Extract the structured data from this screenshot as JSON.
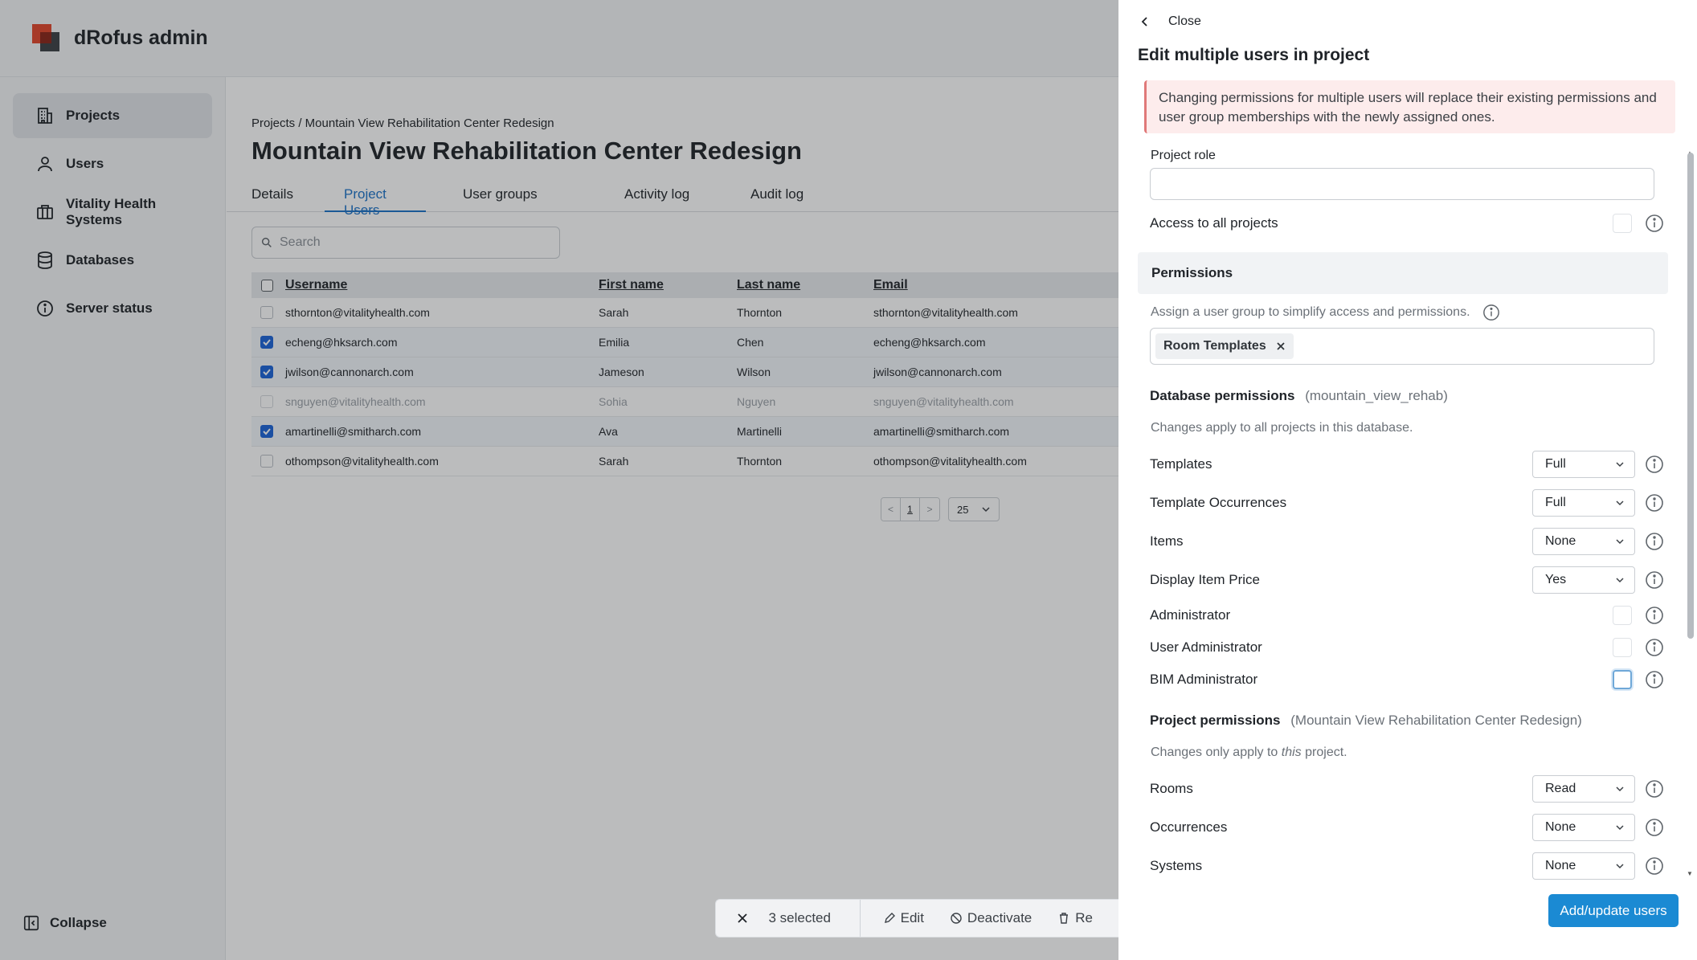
{
  "app": {
    "title": "dRofus admin"
  },
  "sidebar": {
    "items": [
      {
        "label": "Projects",
        "icon": "building-icon",
        "active": true
      },
      {
        "label": "Users",
        "icon": "user-icon",
        "active": false
      },
      {
        "label": "Vitality Health Systems",
        "icon": "briefcase-icon",
        "active": false
      },
      {
        "label": "Databases",
        "icon": "database-icon",
        "active": false
      },
      {
        "label": "Server status",
        "icon": "info-circle-icon",
        "active": false
      }
    ],
    "collapse_label": "Collapse"
  },
  "main": {
    "breadcrumb": "Projects / Mountain View Rehabilitation Center Redesign",
    "title": "Mountain View Rehabilitation Center Redesign",
    "tabs": [
      {
        "label": "Details",
        "active": false
      },
      {
        "label": "Project Users",
        "active": true
      },
      {
        "label": "User groups",
        "active": false
      },
      {
        "label": "Activity log",
        "active": false
      },
      {
        "label": "Audit log",
        "active": false
      }
    ],
    "search_placeholder": "Search",
    "table": {
      "headers": {
        "username": "Username",
        "first": "First name",
        "last": "Last name",
        "email": "Email"
      },
      "rows": [
        {
          "username": "sthornton@vitalityhealth.com",
          "first": "Sarah",
          "last": "Thornton",
          "email": "sthornton@vitalityhealth.com",
          "checked": false,
          "disabled": false
        },
        {
          "username": "echeng@hksarch.com",
          "first": "Emilia",
          "last": "Chen",
          "email": "echeng@hksarch.com",
          "checked": true,
          "disabled": false
        },
        {
          "username": "jwilson@cannonarch.com",
          "first": "Jameson",
          "last": "Wilson",
          "email": "jwilson@cannonarch.com",
          "checked": true,
          "disabled": false
        },
        {
          "username": "snguyen@vitalityhealth.com",
          "first": "Sohia",
          "last": "Nguyen",
          "email": "snguyen@vitalityhealth.com",
          "checked": false,
          "disabled": true
        },
        {
          "username": "amartinelli@smitharch.com",
          "first": "Ava",
          "last": "Martinelli",
          "email": "amartinelli@smitharch.com",
          "checked": true,
          "disabled": false
        },
        {
          "username": "othompson@vitalityhealth.com",
          "first": "Sarah",
          "last": "Thornton",
          "email": "othompson@vitalityhealth.com",
          "checked": false,
          "disabled": false
        }
      ]
    },
    "pager": {
      "prev": "<",
      "page": "1",
      "next": ">",
      "page_size": "25"
    }
  },
  "actionbar": {
    "count": "3 selected",
    "edit": "Edit",
    "deactivate": "Deactivate",
    "remove": "Re"
  },
  "panel": {
    "close_label": "Close",
    "title": "Edit multiple users in project",
    "alert": "Changing permissions for multiple users will replace their existing permissions and user group memberships with the newly assigned ones.",
    "project_role_label": "Project role",
    "project_role_value": "",
    "access_all_label": "Access to all projects",
    "permissions_heading": "Permissions",
    "user_group_hint": "Assign a user group to simplify access and permissions.",
    "user_group_tag": "Room Templates",
    "db_heading": "Database permissions",
    "db_name": "(mountain_view_rehab)",
    "db_note": "Changes apply to all projects in this database.",
    "db_perms": [
      {
        "name": "Templates",
        "value": "Full"
      },
      {
        "name": "Template Occurrences",
        "value": "Full"
      },
      {
        "name": "Items",
        "value": "None"
      },
      {
        "name": "Display Item Price",
        "value": "Yes"
      }
    ],
    "db_checks": [
      {
        "name": "Administrator",
        "checked": false
      },
      {
        "name": "User Administrator",
        "checked": false
      },
      {
        "name": "BIM Administrator",
        "checked": false
      }
    ],
    "proj_heading": "Project permissions",
    "proj_name": "(Mountain View Rehabilitation Center Redesign)",
    "proj_note_pre": "Changes only apply to ",
    "proj_note_em": "this",
    "proj_note_post": " project.",
    "proj_perms": [
      {
        "name": "Rooms",
        "value": "Read"
      },
      {
        "name": "Occurrences",
        "value": "None"
      },
      {
        "name": "Systems",
        "value": "None"
      }
    ],
    "submit_label": "Add/update users"
  },
  "colors": {
    "accent": "#1b8ad3",
    "tab_active": "#1b72c7",
    "checkbox": "#1b64d8",
    "alert_bg": "#fdecec"
  }
}
